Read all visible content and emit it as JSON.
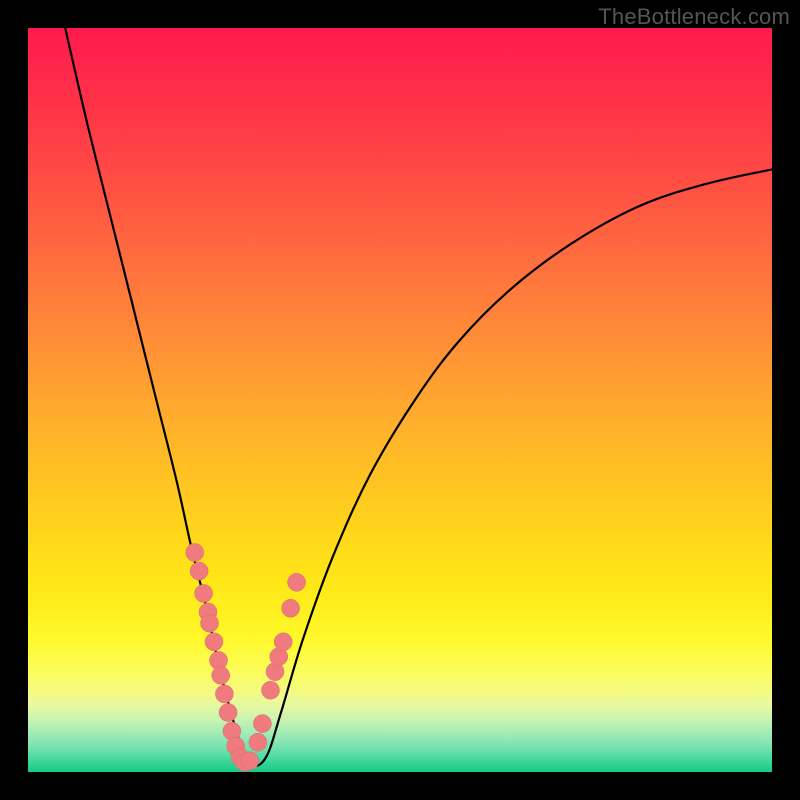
{
  "watermark": "TheBottleneck.com",
  "chart_data": {
    "type": "line",
    "title": "",
    "xlabel": "",
    "ylabel": "",
    "xlim": [
      0,
      100
    ],
    "ylim": [
      0,
      100
    ],
    "grid": false,
    "legend": false,
    "series": [
      {
        "name": "bottleneck-curve",
        "x": [
          5,
          8,
          11,
          14,
          17,
          20,
          22,
          24,
          25.5,
          27,
          28.5,
          30,
          32,
          34,
          37,
          41,
          46,
          52,
          58,
          65,
          73,
          82,
          91,
          100
        ],
        "y": [
          100,
          87,
          75,
          63,
          51,
          39,
          30,
          22,
          15,
          9,
          4,
          1,
          2,
          8,
          18,
          29,
          40,
          50,
          58,
          65,
          71,
          76,
          79,
          81
        ]
      }
    ],
    "markers": {
      "name": "highlighted-points",
      "x_pct": [
        22.4,
        23.0,
        23.6,
        24.2,
        24.4,
        25.0,
        25.6,
        25.9,
        26.4,
        26.9,
        27.4,
        27.9,
        28.5,
        29.1,
        29.8,
        30.9,
        31.5,
        32.6,
        33.2,
        33.7,
        34.3,
        35.3,
        36.1
      ],
      "y_pct": [
        29.5,
        27.0,
        24.0,
        21.5,
        20.0,
        17.5,
        15.0,
        13.0,
        10.5,
        8.0,
        5.5,
        3.5,
        2.0,
        1.3,
        1.5,
        4.0,
        6.5,
        11.0,
        13.5,
        15.5,
        17.5,
        22.0,
        25.5
      ]
    }
  }
}
